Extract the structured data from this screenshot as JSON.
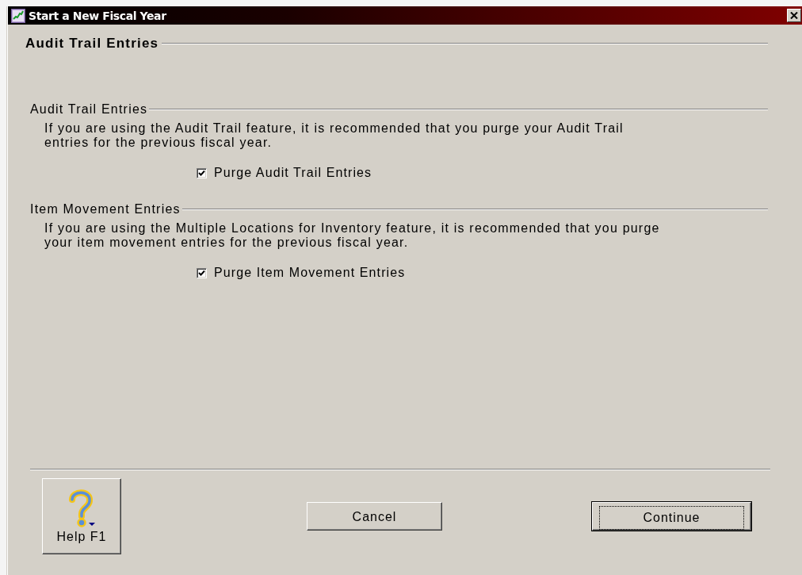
{
  "window": {
    "title": "Start a New Fiscal Year"
  },
  "page_heading": "Audit Trail Entries",
  "groups": [
    {
      "heading": "Audit Trail Entries",
      "description": "If you are using the Audit Trail feature, it is recommended that you purge your Audit Trail entries for the previous fiscal year.",
      "option": {
        "label": "Purge Audit Trail Entries",
        "checked": true
      }
    },
    {
      "heading": "Item Movement Entries",
      "description": "If you are using the Multiple Locations for Inventory feature, it is recommended that you purge your item movement entries for the previous fiscal year.",
      "option": {
        "label": "Purge Item Movement Entries",
        "checked": true
      }
    }
  ],
  "buttons": [
    {
      "kind": "help",
      "label": "Help F1"
    },
    {
      "kind": "push",
      "label": "Cancel",
      "default": false
    },
    {
      "kind": "push",
      "label": "Continue",
      "default": true
    }
  ]
}
